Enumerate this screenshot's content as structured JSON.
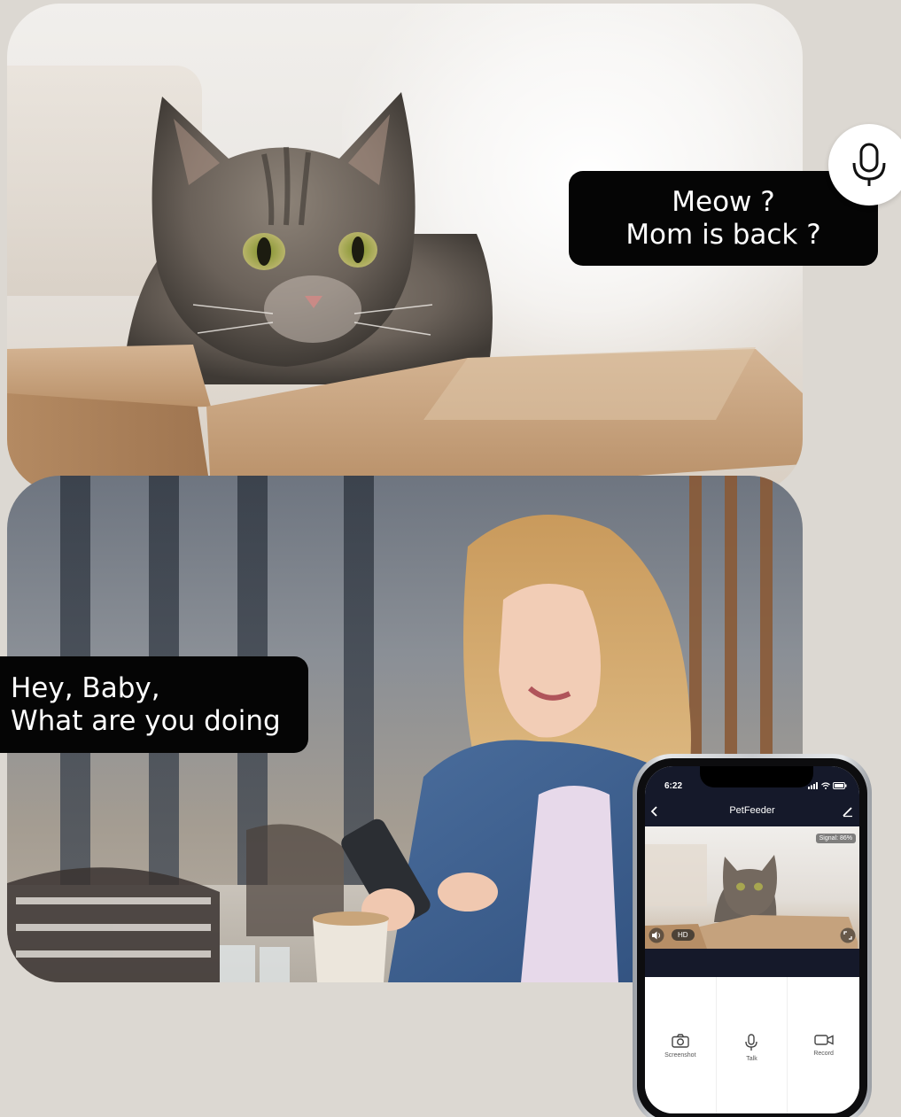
{
  "bubbles": {
    "cat_line1": "Meow ?",
    "cat_line2": "Mom is back ?",
    "owner_line1": "Hey, Baby,",
    "owner_line2": "What are you doing"
  },
  "phone": {
    "status_time": "6:22",
    "app_title": "PetFeeder",
    "signal_label": "Signal: 86%",
    "quality_label": "HD",
    "controls": [
      {
        "label": "Screenshot",
        "icon": "camera-icon"
      },
      {
        "label": "Talk",
        "icon": "microphone-icon"
      },
      {
        "label": "Record",
        "icon": "video-camera-icon"
      }
    ]
  },
  "colors": {
    "background": "#dcd8d2",
    "bubble": "#050505",
    "app_header": "#15192a"
  }
}
